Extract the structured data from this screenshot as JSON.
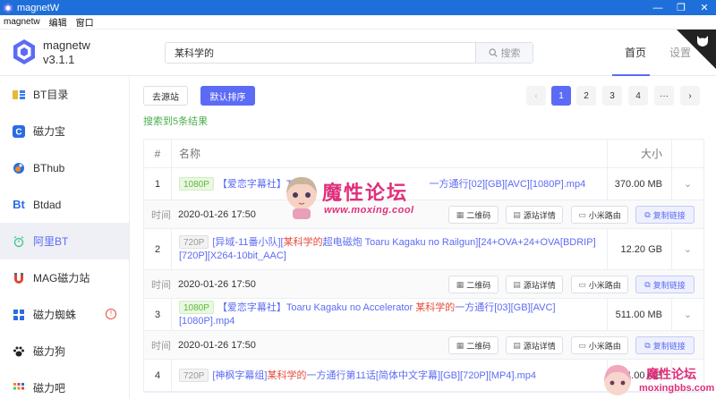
{
  "window": {
    "title": "magnetW",
    "minimize": "—",
    "maximize": "❐",
    "close": "✕"
  },
  "menu": [
    "magnetw",
    "编辑",
    "窗口"
  ],
  "header": {
    "app_name": "magnetw",
    "version": "v3.1.1",
    "search_value": "某科学的",
    "search_button": "搜索",
    "nav_home": "首页",
    "nav_settings": "设置"
  },
  "sidebar": {
    "items": [
      {
        "label": "BT目录",
        "icon": "bt-catalog-icon",
        "active": false
      },
      {
        "label": "磁力宝",
        "icon": "c-logo-icon",
        "active": false
      },
      {
        "label": "BThub",
        "icon": "globe-icon",
        "active": false
      },
      {
        "label": "Btdad",
        "icon": "bt-letters-icon",
        "active": false
      },
      {
        "label": "阿里BT",
        "icon": "alarm-icon",
        "active": true
      },
      {
        "label": "MAG磁力站",
        "icon": "magnet-icon",
        "active": false
      },
      {
        "label": "磁力蜘蛛",
        "icon": "spider-icon",
        "active": false,
        "warning": true
      },
      {
        "label": "磁力狗",
        "icon": "paw-icon",
        "active": false
      },
      {
        "label": "磁力吧",
        "icon": "grid-icon",
        "active": false
      }
    ]
  },
  "toolbar": {
    "source_button": "去源站",
    "sort_button": "默认排序",
    "pages": [
      "1",
      "2",
      "3",
      "4",
      "···"
    ],
    "prev": "‹",
    "next": "›",
    "active_page": "1"
  },
  "result_text": "搜索到5条结果",
  "table": {
    "headers": {
      "index": "#",
      "name": "名称",
      "size": "大小"
    },
    "time_label": "时间",
    "actions": {
      "qrcode": "二维码",
      "source_detail": "源站详情",
      "xiaomi": "小米路由",
      "copy": "复制链接"
    },
    "rows": [
      {
        "index": "1",
        "tag": "1080P",
        "tag_style": "green",
        "name_pre": "【爱恋字幕社】To",
        "name_hl": "",
        "name_post": "一方通行[02][GB][AVC][1080P].mp4",
        "size": "370.00 MB",
        "time": "2020-01-26 17:50"
      },
      {
        "index": "2",
        "tag": "720P",
        "tag_style": "gray",
        "name_pre": "[异域-11番小队][",
        "name_hl": "某科学的",
        "name_post": "超电磁炮 Toaru Kagaku no Railgun][24+OVA+24+OVA[BDRIP][720P][X264-10bit_AAC]",
        "size": "12.20 GB",
        "time": "2020-01-26 17:50"
      },
      {
        "index": "3",
        "tag": "1080P",
        "tag_style": "green",
        "name_pre": "【爱恋字幕社】Toaru Kagaku no Accelerator ",
        "name_hl": "某科学的",
        "name_post": "一方通行[03][GB][AVC][1080P].mp4",
        "size": "511.00 MB",
        "time": "2020-01-26 17:50"
      },
      {
        "index": "4",
        "tag": "720P",
        "tag_style": "gray",
        "name_pre": "[神枫字幕组]",
        "name_hl": "某科学的",
        "name_post": "一方通行第11话[简体中文字幕][GB][720P][MP4].mp4",
        "size": "4.00 MB",
        "time": ""
      }
    ]
  },
  "watermark": {
    "title": "魔性论坛",
    "url": "www.moxing.cool",
    "corner_title": "魔性论坛",
    "corner_url": "moxingbbs.com"
  },
  "colors": {
    "accent": "#5c6bf5",
    "title_bar": "#1e6fd9",
    "highlight": "#e74c3c",
    "green": "#4caf50",
    "watermark": "#e0307c"
  }
}
